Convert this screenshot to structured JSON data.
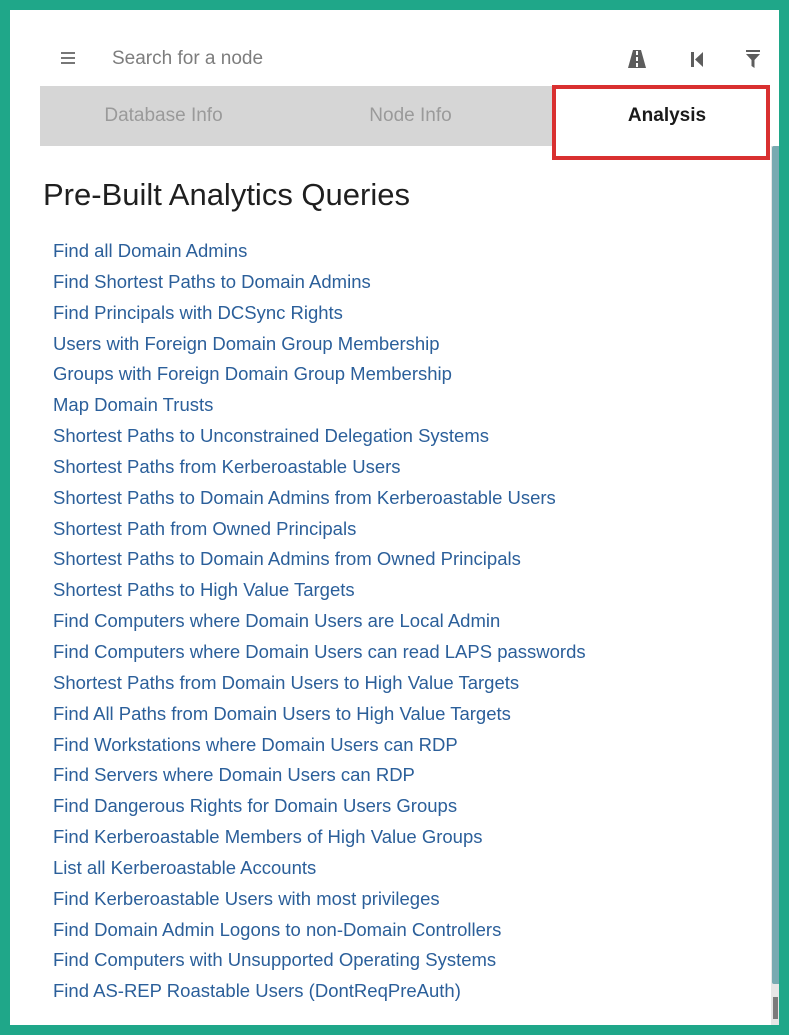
{
  "search": {
    "placeholder": "Search for a node"
  },
  "toolbar": {
    "icons": [
      "hamburger-menu-icon",
      "pathfinding-road-icon",
      "back-icon",
      "filter-icon"
    ]
  },
  "tabs": [
    {
      "label": "Database Info",
      "active": false
    },
    {
      "label": "Node Info",
      "active": false
    },
    {
      "label": "Analysis",
      "active": true
    }
  ],
  "analysis": {
    "heading": "Pre-Built Analytics Queries",
    "queries": [
      "Find all Domain Admins",
      "Find Shortest Paths to Domain Admins",
      "Find Principals with DCSync Rights",
      "Users with Foreign Domain Group Membership",
      "Groups with Foreign Domain Group Membership",
      "Map Domain Trusts",
      "Shortest Paths to Unconstrained Delegation Systems",
      "Shortest Paths from Kerberoastable Users",
      "Shortest Paths to Domain Admins from Kerberoastable Users",
      "Shortest Path from Owned Principals",
      "Shortest Paths to Domain Admins from Owned Principals",
      "Shortest Paths to High Value Targets",
      "Find Computers where Domain Users are Local Admin",
      "Find Computers where Domain Users can read LAPS passwords",
      "Shortest Paths from Domain Users to High Value Targets",
      "Find All Paths from Domain Users to High Value Targets",
      "Find Workstations where Domain Users can RDP",
      "Find Servers where Domain Users can RDP",
      "Find Dangerous Rights for Domain Users Groups",
      "Find Kerberoastable Members of High Value Groups",
      "List all Kerberoastable Accounts",
      "Find Kerberoastable Users with most privileges",
      "Find Domain Admin Logons to non-Domain Controllers",
      "Find Computers with Unsupported Operating Systems",
      "Find AS-REP Roastable Users (DontReqPreAuth)"
    ]
  },
  "colors": {
    "frame_border": "#1fa789",
    "tab_bar": "#d6d6d6",
    "link": "#2b5f9a",
    "highlight": "#d93030",
    "scroll_thumb": "#78aab1"
  }
}
